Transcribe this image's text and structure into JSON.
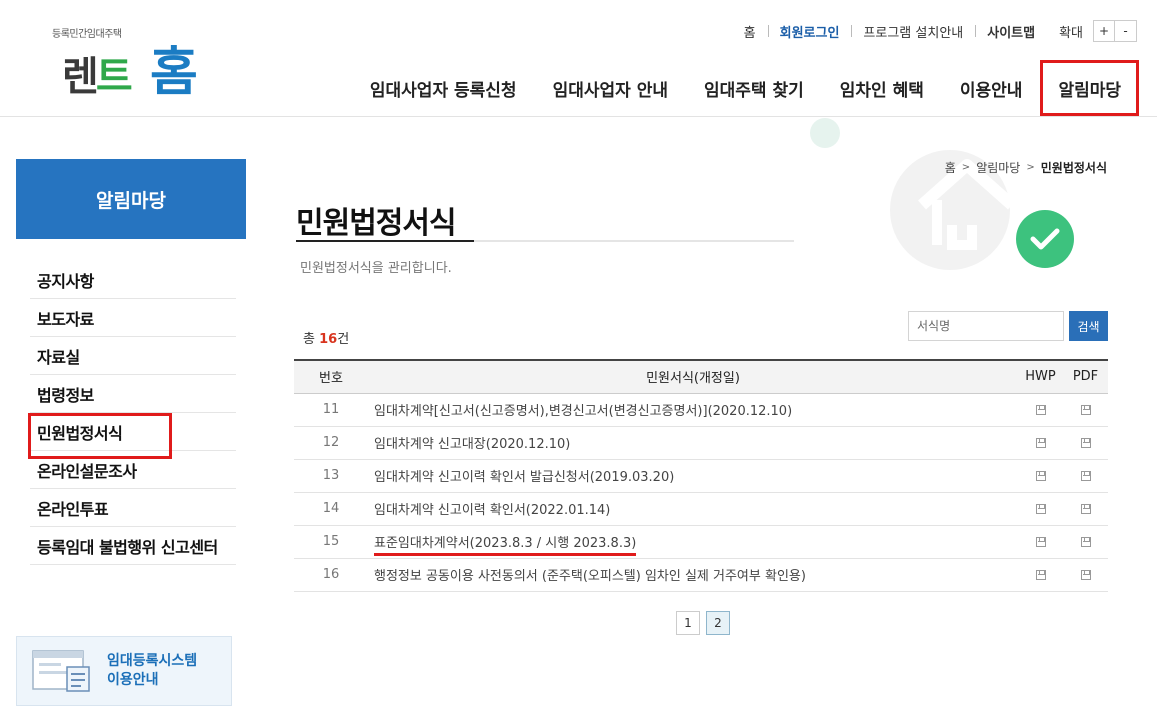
{
  "logo": {
    "tagline": "등록민간임대주택",
    "brand_a": "렌",
    "brand_b": "트",
    "brand_c": "홈"
  },
  "util": {
    "home": "홈",
    "login": "회원로그인",
    "program": "프로그램 설치안내",
    "sitemap": "사이트맵",
    "zoom": "확대",
    "zoom_in": "+",
    "zoom_out": "-"
  },
  "gnb": [
    "임대사업자 등록신청",
    "임대사업자 안내",
    "임대주택 찾기",
    "임차인 혜택",
    "이용안내",
    "알림마당"
  ],
  "sidebar": {
    "title": "알림마당",
    "items": [
      "공지사항",
      "보도자료",
      "자료실",
      "법령정보",
      "민원법정서식",
      "온라인설문조사",
      "온라인투표",
      "등록임대 불법행위 신고센터"
    ],
    "banner": {
      "line1": "임대등록시스템",
      "line2": "이용안내"
    }
  },
  "breadcrumb": {
    "home": "홈",
    "sep": ">",
    "parent": "알림마당",
    "current": "민원법정서식"
  },
  "page": {
    "title": "민원법정서식",
    "desc": "민원법정서식을 관리합니다."
  },
  "list": {
    "total_prefix": "총 ",
    "total_count": "16",
    "total_suffix": "건",
    "search_placeholder": "서식명",
    "search_button": "검색",
    "headers": {
      "no": "번호",
      "title": "민원서식(개정일)",
      "hwp": "HWP",
      "pdf": "PDF"
    },
    "rows": [
      {
        "no": "11",
        "title": "임대차계약[신고서(신고증명서),변경신고서(변경신고증명서)](2020.12.10)"
      },
      {
        "no": "12",
        "title": "임대차계약 신고대장(2020.12.10)"
      },
      {
        "no": "13",
        "title": "임대차계약 신고이력 확인서 발급신청서(2019.03.20)"
      },
      {
        "no": "14",
        "title": "임대차계약 신고이력 확인서(2022.01.14)"
      },
      {
        "no": "15",
        "title": "표준임대차계약서(2023.8.3 / 시행 2023.8.3)"
      },
      {
        "no": "16",
        "title": "행정정보 공동이용 사전동의서 (준주택(오피스텔) 임차인 실제 거주여부 확인용)"
      }
    ]
  },
  "pager": [
    "1",
    "2"
  ],
  "colors": {
    "primary": "#2674c0",
    "highlight": "#e01b1b",
    "count": "#d8341e",
    "check": "#3dc27e"
  }
}
